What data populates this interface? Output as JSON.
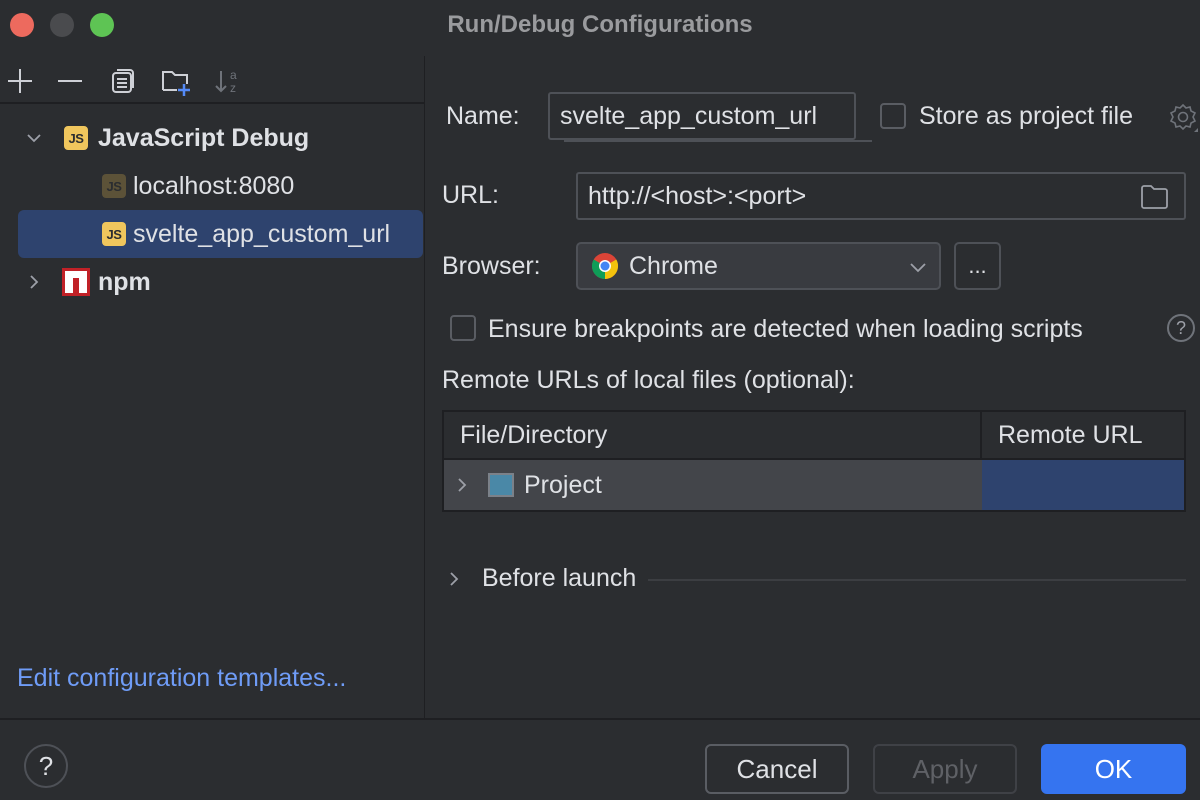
{
  "window": {
    "title": "Run/Debug Configurations"
  },
  "toolbar": {
    "icons": [
      "add-icon",
      "remove-icon",
      "copy-icon",
      "new-folder-icon",
      "sort-alphabetically-icon"
    ]
  },
  "tree": {
    "groups": [
      {
        "label": "JavaScript Debug",
        "icon": "javascript-icon",
        "icon_text": "JS",
        "expanded": true,
        "children": [
          {
            "label": "localhost:8080",
            "icon": "javascript-icon",
            "icon_text": "JS",
            "selected": false
          },
          {
            "label": "svelte_app_custom_url",
            "icon": "javascript-icon",
            "icon_text": "JS",
            "selected": true
          }
        ]
      },
      {
        "label": "npm",
        "icon": "npm-icon",
        "expanded": false,
        "children": []
      }
    ]
  },
  "left_footer": {
    "edit_templates_link": "Edit configuration templates..."
  },
  "form": {
    "name_label": "Name:",
    "name_value": "svelte_app_custom_url",
    "store_as_project_file_label": "Store as project file",
    "store_as_project_file_checked": false,
    "url_label": "URL:",
    "url_value": "http://<host>:<port>",
    "browser_label": "Browser:",
    "browser_value": "Chrome",
    "browser_more_label": "...",
    "ensure_breakpoints_label": "Ensure breakpoints are detected when loading scripts",
    "ensure_breakpoints_checked": false,
    "remote_urls_label": "Remote URLs of local files (optional):"
  },
  "remote_table": {
    "columns": [
      "File/Directory",
      "Remote URL"
    ],
    "rows": [
      {
        "file": "Project",
        "remote_url": "",
        "expandable": true
      }
    ]
  },
  "before_launch": {
    "label": "Before launch",
    "expanded": false
  },
  "footer": {
    "help_label": "?",
    "cancel_label": "Cancel",
    "apply_label": "Apply",
    "apply_enabled": false,
    "ok_label": "OK"
  },
  "colors": {
    "background": "#2b2d30",
    "selection": "#2e436e",
    "accent": "#3574f0",
    "link": "#6f9cf7",
    "js_icon": "#f0c65d",
    "npm_icon": "#c12127"
  }
}
